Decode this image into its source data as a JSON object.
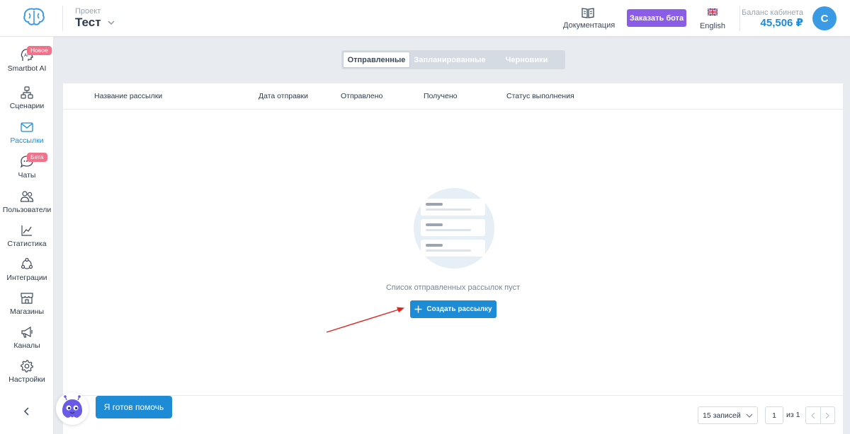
{
  "header": {
    "project_label": "Проект",
    "project_name": "Тест",
    "docs_label": "Документация",
    "order_bot_label": "Заказать бота",
    "language_label": "English",
    "balance_label": "Баланс кабинета",
    "balance_value": "45,506 ₽",
    "avatar_initial": "С"
  },
  "sidebar": {
    "items": [
      {
        "label": "Smartbot AI",
        "badge": "Новое",
        "icon": "ai-head-icon"
      },
      {
        "label": "Сценарии",
        "icon": "flow-icon"
      },
      {
        "label": "Рассылки",
        "icon": "mail-icon",
        "active": true
      },
      {
        "label": "Чаты",
        "badge": "Бета",
        "icon": "chat-icon"
      },
      {
        "label": "Пользователи",
        "icon": "users-icon"
      },
      {
        "label": "Статистика",
        "icon": "chart-icon"
      },
      {
        "label": "Интеграции",
        "icon": "integrations-icon"
      },
      {
        "label": "Магазины",
        "icon": "shop-icon"
      },
      {
        "label": "Каналы",
        "icon": "megaphone-icon"
      },
      {
        "label": "Настройки",
        "icon": "gear-icon"
      }
    ]
  },
  "tabs": [
    {
      "label": "Отправленные",
      "active": true
    },
    {
      "label": "Запланированные"
    },
    {
      "label": "Черновики"
    }
  ],
  "table": {
    "columns": [
      "Название рассылки",
      "Дата отправки",
      "Отправлено",
      "Получено",
      "Статус выполнения"
    ]
  },
  "empty_state": {
    "message": "Список отправленных рассылок пуст",
    "create_label": "Создать рассылку"
  },
  "pagination": {
    "per_page": "15 записей",
    "current_page": "1",
    "of_pages": "из 1"
  },
  "help": {
    "label": "Я готов помочь"
  },
  "colors": {
    "accent": "#1d8bd6",
    "order_button": "#8b5ce6",
    "badge": "#f0728b",
    "annotation_arrow": "#e0231b"
  }
}
